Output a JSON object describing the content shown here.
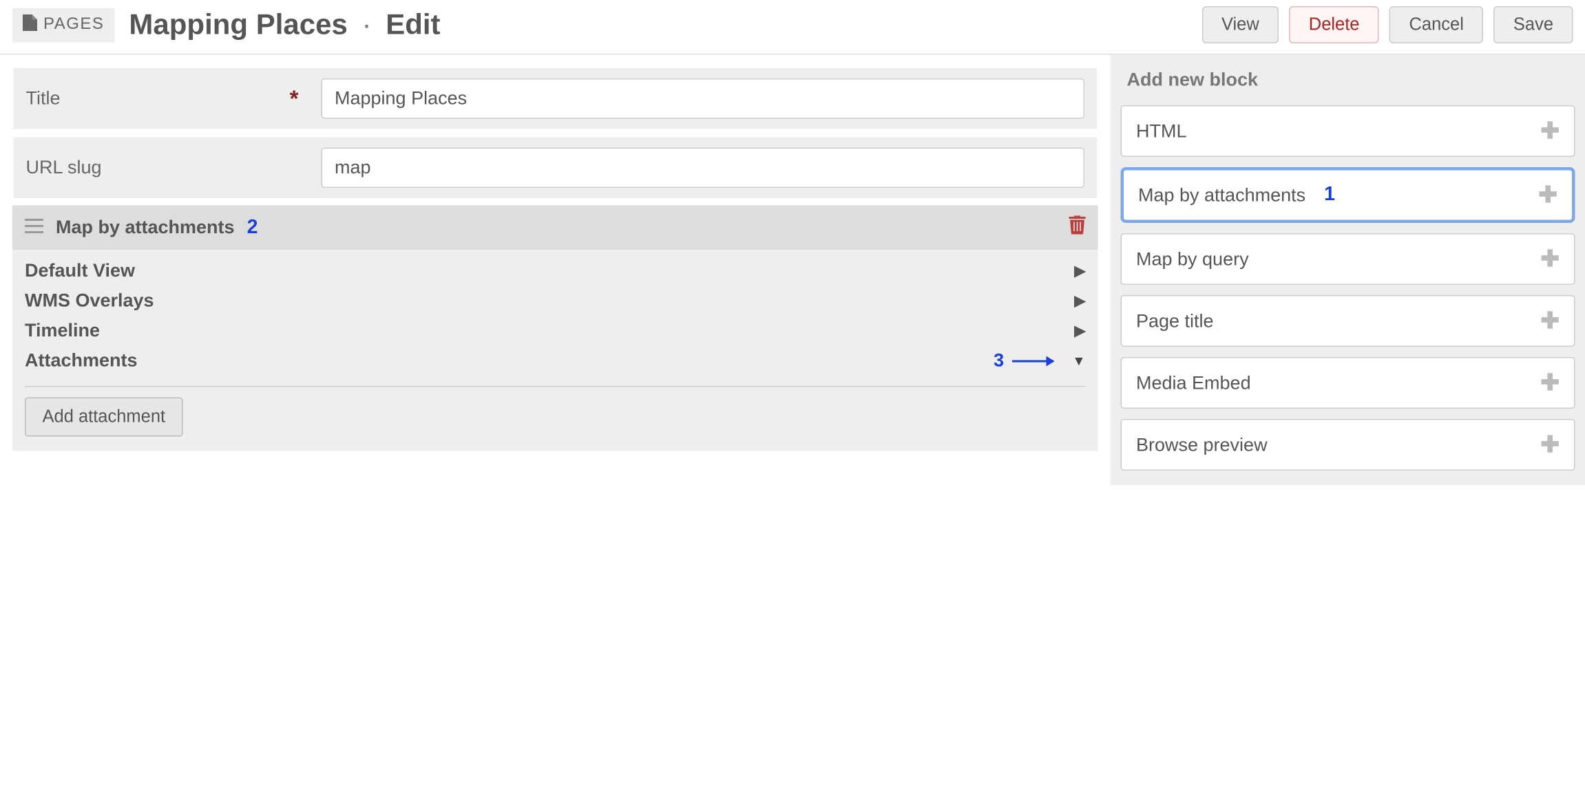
{
  "header": {
    "breadcrumb_label": "PAGES",
    "title": "Mapping Places",
    "separator": "·",
    "mode": "Edit"
  },
  "actions": {
    "view": "View",
    "delete": "Delete",
    "cancel": "Cancel",
    "save": "Save"
  },
  "fields": {
    "title_label": "Title",
    "title_value": "Mapping Places",
    "slug_label": "URL slug",
    "slug_value": "map"
  },
  "block": {
    "name": "Map by attachments",
    "annotation_2": "2",
    "rows": {
      "default_view": "Default View",
      "wms_overlays": "WMS Overlays",
      "timeline": "Timeline",
      "attachments": "Attachments"
    },
    "annotation_3": "3",
    "add_attachment": "Add attachment"
  },
  "sidebar": {
    "header": "Add new block",
    "items": [
      {
        "label": "HTML"
      },
      {
        "label": "Map by attachments",
        "annotation": "1",
        "highlight": true
      },
      {
        "label": "Map by query"
      },
      {
        "label": "Page title"
      },
      {
        "label": "Media Embed"
      },
      {
        "label": "Browse preview"
      }
    ]
  }
}
